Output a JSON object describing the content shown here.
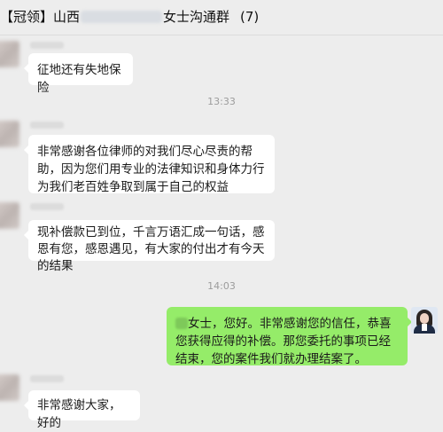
{
  "header": {
    "title_prefix": "【冠领】山西",
    "title_suffix": "女士沟通群",
    "member_count": "(7)"
  },
  "messages": [
    {
      "side": "left",
      "text": "征地还有失地保险"
    },
    {
      "type": "time",
      "text": "13:33"
    },
    {
      "side": "left",
      "text": "非常感谢各位律师的对我们尽心尽责的帮助，因为您们用专业的法律知识和身体力行为我们老百姓争取到属于自己的权益"
    },
    {
      "side": "left",
      "text": "现补偿款已到位，千言万语汇成一句话，感恩有您，感恩遇见，有大家的付出才有今天的结果"
    },
    {
      "type": "time",
      "text": "14:03"
    },
    {
      "side": "right",
      "text": "女士，您好。非常感谢您的信任，恭喜您获得应得的补偿。那您委托的事项已经结束，您的案件我们就办理结案了。"
    },
    {
      "side": "left",
      "text": "非常感谢大家，好的"
    }
  ]
}
